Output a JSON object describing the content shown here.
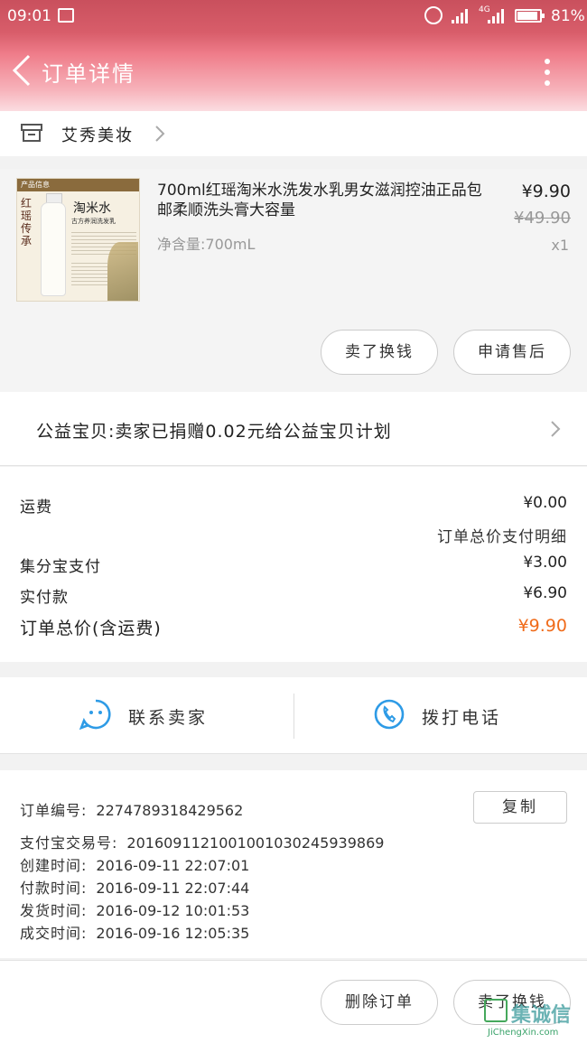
{
  "status_bar": {
    "time": "09:01",
    "network": "4G",
    "battery": "81%"
  },
  "nav": {
    "title": "订单详情"
  },
  "shop": {
    "name": "艾秀美妆"
  },
  "product": {
    "image_text": {
      "band": "产品信息",
      "vertical": "红瑶传承",
      "brand": "淘米水",
      "subtitle": "古方养润洗发乳"
    },
    "title": "700ml红瑶淘米水洗发水乳男女滋润控油正品包邮柔顺洗头膏大容量",
    "spec": "净含量:700mL",
    "price": "¥9.90",
    "original_price": "¥49.90",
    "quantity": "x1"
  },
  "product_actions": {
    "resell_label": "卖了换钱",
    "after_sale_label": "申请售后"
  },
  "charity": {
    "text": "公益宝贝:卖家已捐赠0.02元给公益宝贝计划"
  },
  "costs": {
    "shipping_label": "运费",
    "shipping_value": "¥0.00",
    "detail_link": "订单总价支付明细",
    "points_label": "集分宝支付",
    "points_value": "¥3.00",
    "paid_label": "实付款",
    "paid_value": "¥6.90",
    "total_label": "订单总价(含运费)",
    "total_value": "¥9.90",
    "total_color": "#f06b1a"
  },
  "contact": {
    "seller_label": "联系卖家",
    "phone_label": "拨打电话",
    "icon_color": "#2e9be6"
  },
  "order_info": {
    "order_no_label": "订单编号:",
    "order_no": "2274789318429562",
    "copy_label": "复制",
    "alipay_label": "支付宝交易号:",
    "alipay_no": "2016091121001001030245939869",
    "created_label": "创建时间:",
    "created": "2016-09-11 22:07:01",
    "paid_label": "付款时间:",
    "paid": "2016-09-11 22:07:44",
    "shipped_label": "发货时间:",
    "shipped": "2016-09-12 10:01:53",
    "completed_label": "成交时间:",
    "completed": "2016-09-16 12:05:35"
  },
  "bottom_actions": {
    "delete_label": "删除订单",
    "resell_label": "卖了换钱"
  },
  "watermark": {
    "brand": "集诚信",
    "url": "JiChengXin.com"
  }
}
